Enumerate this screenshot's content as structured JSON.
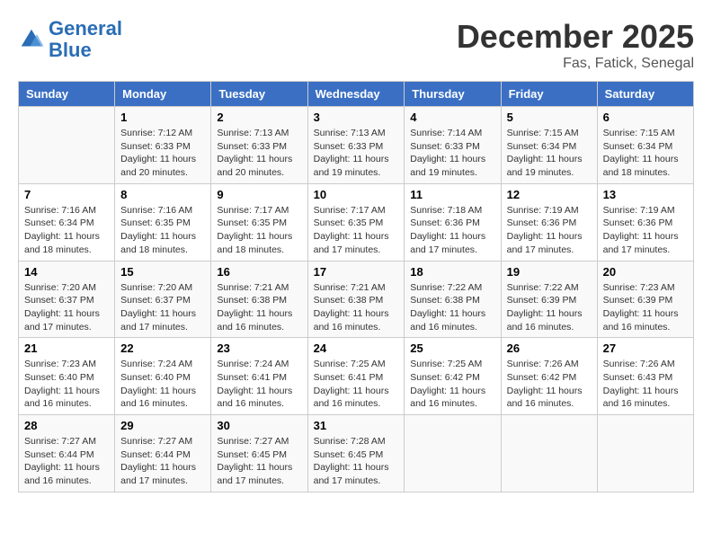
{
  "header": {
    "logo_line1": "General",
    "logo_line2": "Blue",
    "month": "December 2025",
    "location": "Fas, Fatick, Senegal"
  },
  "days_of_week": [
    "Sunday",
    "Monday",
    "Tuesday",
    "Wednesday",
    "Thursday",
    "Friday",
    "Saturday"
  ],
  "weeks": [
    [
      {
        "num": "",
        "info": ""
      },
      {
        "num": "1",
        "info": "Sunrise: 7:12 AM\nSunset: 6:33 PM\nDaylight: 11 hours\nand 20 minutes."
      },
      {
        "num": "2",
        "info": "Sunrise: 7:13 AM\nSunset: 6:33 PM\nDaylight: 11 hours\nand 20 minutes."
      },
      {
        "num": "3",
        "info": "Sunrise: 7:13 AM\nSunset: 6:33 PM\nDaylight: 11 hours\nand 19 minutes."
      },
      {
        "num": "4",
        "info": "Sunrise: 7:14 AM\nSunset: 6:33 PM\nDaylight: 11 hours\nand 19 minutes."
      },
      {
        "num": "5",
        "info": "Sunrise: 7:15 AM\nSunset: 6:34 PM\nDaylight: 11 hours\nand 19 minutes."
      },
      {
        "num": "6",
        "info": "Sunrise: 7:15 AM\nSunset: 6:34 PM\nDaylight: 11 hours\nand 18 minutes."
      }
    ],
    [
      {
        "num": "7",
        "info": "Sunrise: 7:16 AM\nSunset: 6:34 PM\nDaylight: 11 hours\nand 18 minutes."
      },
      {
        "num": "8",
        "info": "Sunrise: 7:16 AM\nSunset: 6:35 PM\nDaylight: 11 hours\nand 18 minutes."
      },
      {
        "num": "9",
        "info": "Sunrise: 7:17 AM\nSunset: 6:35 PM\nDaylight: 11 hours\nand 18 minutes."
      },
      {
        "num": "10",
        "info": "Sunrise: 7:17 AM\nSunset: 6:35 PM\nDaylight: 11 hours\nand 17 minutes."
      },
      {
        "num": "11",
        "info": "Sunrise: 7:18 AM\nSunset: 6:36 PM\nDaylight: 11 hours\nand 17 minutes."
      },
      {
        "num": "12",
        "info": "Sunrise: 7:19 AM\nSunset: 6:36 PM\nDaylight: 11 hours\nand 17 minutes."
      },
      {
        "num": "13",
        "info": "Sunrise: 7:19 AM\nSunset: 6:36 PM\nDaylight: 11 hours\nand 17 minutes."
      }
    ],
    [
      {
        "num": "14",
        "info": "Sunrise: 7:20 AM\nSunset: 6:37 PM\nDaylight: 11 hours\nand 17 minutes."
      },
      {
        "num": "15",
        "info": "Sunrise: 7:20 AM\nSunset: 6:37 PM\nDaylight: 11 hours\nand 17 minutes."
      },
      {
        "num": "16",
        "info": "Sunrise: 7:21 AM\nSunset: 6:38 PM\nDaylight: 11 hours\nand 16 minutes."
      },
      {
        "num": "17",
        "info": "Sunrise: 7:21 AM\nSunset: 6:38 PM\nDaylight: 11 hours\nand 16 minutes."
      },
      {
        "num": "18",
        "info": "Sunrise: 7:22 AM\nSunset: 6:38 PM\nDaylight: 11 hours\nand 16 minutes."
      },
      {
        "num": "19",
        "info": "Sunrise: 7:22 AM\nSunset: 6:39 PM\nDaylight: 11 hours\nand 16 minutes."
      },
      {
        "num": "20",
        "info": "Sunrise: 7:23 AM\nSunset: 6:39 PM\nDaylight: 11 hours\nand 16 minutes."
      }
    ],
    [
      {
        "num": "21",
        "info": "Sunrise: 7:23 AM\nSunset: 6:40 PM\nDaylight: 11 hours\nand 16 minutes."
      },
      {
        "num": "22",
        "info": "Sunrise: 7:24 AM\nSunset: 6:40 PM\nDaylight: 11 hours\nand 16 minutes."
      },
      {
        "num": "23",
        "info": "Sunrise: 7:24 AM\nSunset: 6:41 PM\nDaylight: 11 hours\nand 16 minutes."
      },
      {
        "num": "24",
        "info": "Sunrise: 7:25 AM\nSunset: 6:41 PM\nDaylight: 11 hours\nand 16 minutes."
      },
      {
        "num": "25",
        "info": "Sunrise: 7:25 AM\nSunset: 6:42 PM\nDaylight: 11 hours\nand 16 minutes."
      },
      {
        "num": "26",
        "info": "Sunrise: 7:26 AM\nSunset: 6:42 PM\nDaylight: 11 hours\nand 16 minutes."
      },
      {
        "num": "27",
        "info": "Sunrise: 7:26 AM\nSunset: 6:43 PM\nDaylight: 11 hours\nand 16 minutes."
      }
    ],
    [
      {
        "num": "28",
        "info": "Sunrise: 7:27 AM\nSunset: 6:44 PM\nDaylight: 11 hours\nand 16 minutes."
      },
      {
        "num": "29",
        "info": "Sunrise: 7:27 AM\nSunset: 6:44 PM\nDaylight: 11 hours\nand 17 minutes."
      },
      {
        "num": "30",
        "info": "Sunrise: 7:27 AM\nSunset: 6:45 PM\nDaylight: 11 hours\nand 17 minutes."
      },
      {
        "num": "31",
        "info": "Sunrise: 7:28 AM\nSunset: 6:45 PM\nDaylight: 11 hours\nand 17 minutes."
      },
      {
        "num": "",
        "info": ""
      },
      {
        "num": "",
        "info": ""
      },
      {
        "num": "",
        "info": ""
      }
    ]
  ]
}
